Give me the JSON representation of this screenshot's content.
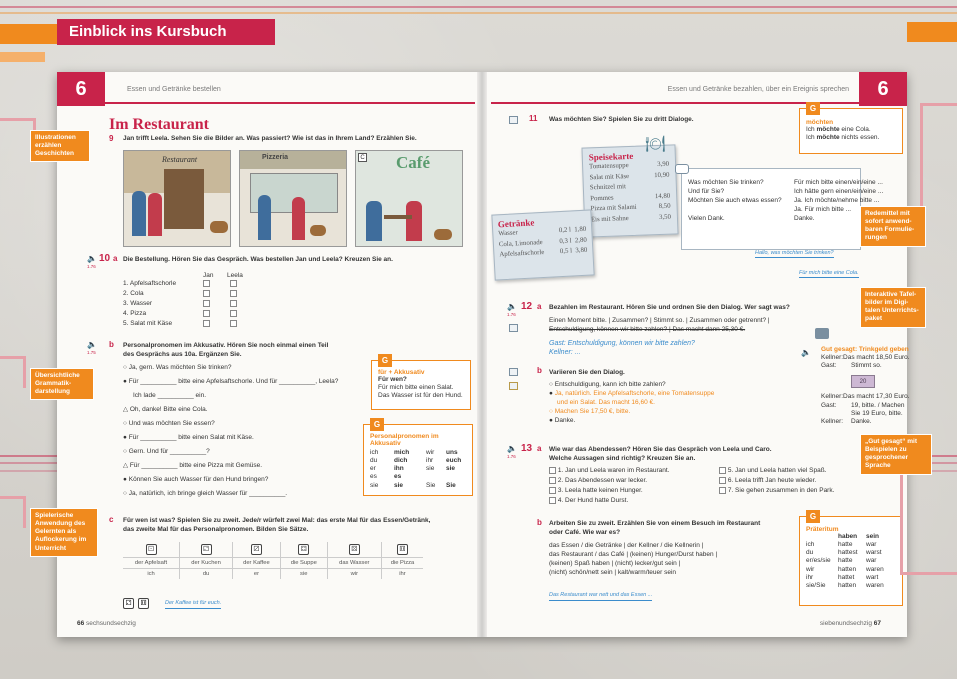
{
  "banner": {
    "title": "Einblick ins Kursbuch"
  },
  "colors": {
    "brand_red": "#c8234a",
    "accent_orange": "#f08a1e",
    "handwriting_blue": "#3b8ccc"
  },
  "left_page": {
    "chapter": "6",
    "running_head": "Essen und Getränke bestellen",
    "title": "Im Restaurant",
    "ex9": {
      "num": "9",
      "text": "Jan trifft Leela. Sehen Sie die Bilder an. Was passiert? Wie ist das in Ihrem Land? Erzählen Sie."
    },
    "illustrations": [
      {
        "label": "A",
        "sign": "Restaurant"
      },
      {
        "label": "B",
        "sign": "Pizzeria"
      },
      {
        "label": "C",
        "sign": "Café"
      }
    ],
    "ex10a": {
      "num": "10",
      "letter": "a",
      "track": "1.76",
      "text": "Die Bestellung. Hören Sie das Gespräch. Was bestellen Jan und Leela? Kreuzen Sie an.",
      "col_jan": "Jan",
      "col_leela": "Leela",
      "items": [
        "1. Apfelsaftschorle",
        "2. Cola",
        "3. Wasser",
        "4. Pizza",
        "5. Salat mit Käse"
      ]
    },
    "ex10b": {
      "letter": "b",
      "track": "1.75",
      "text1": "Personalpronomen im Akkusativ. Hören Sie noch einmal einen Teil",
      "text2": "des Gesprächs aus 10a. Ergänzen Sie.",
      "lines": [
        "Ja, gern. Was möchten Sie trinken?",
        "Für __________ bitte eine Apfelsaftschorle. Und für __________, Leela?",
        "Ich lade __________ ein.",
        "Oh, danke! Bitte eine Cola.",
        "Und was möchten Sie essen?",
        "Für __________ bitte einen Salat mit Käse.",
        "Gern. Und für __________?",
        "Für __________ bitte eine Pizza mit Gemüse.",
        "Können Sie auch Wasser für den Hund bringen?",
        "Ja, natürlich, ich bringe gleich Wasser für __________."
      ]
    },
    "grammar_fuer": {
      "badge": "G",
      "title": "für + Akkusativ",
      "lines": [
        "Für wen?",
        "Für mich bitte einen Salat.",
        "Das Wasser ist für den Hund."
      ]
    },
    "grammar_pron": {
      "badge": "G",
      "title": "Personalpronomen im Akkusativ",
      "rows": [
        [
          "ich",
          "mich",
          "wir",
          "uns"
        ],
        [
          "du",
          "dich",
          "ihr",
          "euch"
        ],
        [
          "er",
          "ihn",
          "sie",
          "sie"
        ],
        [
          "es",
          "es",
          "",
          ""
        ],
        [
          "sie",
          "sie",
          "Sie",
          "Sie"
        ]
      ]
    },
    "ex10c": {
      "letter": "c",
      "text1": "Für wen ist was? Spielen Sie zu zweit. Jede/r würfelt zwei Mal: das erste Mal für das Essen/Getränk,",
      "text2": "das zweite Mal für das Personalpronomen. Bilden Sie Sätze.",
      "dice": [
        "⚀",
        "⚁",
        "⚂",
        "⚃",
        "⚄",
        "⚅"
      ],
      "items": [
        "der Apfelsaft",
        "der Kuchen",
        "der Kaffee",
        "die Suppe",
        "das Wasser",
        "die Pizza"
      ],
      "pronouns": [
        "ich",
        "du",
        "er",
        "sie",
        "wir",
        "ihr"
      ],
      "example_dice": [
        "⚁",
        "⚅"
      ],
      "example": "Der Kaffee ist für euch."
    },
    "page_footer": {
      "num": "66",
      "word": "sechsundsechzig"
    }
  },
  "right_page": {
    "chapter": "6",
    "running_head": "Essen und Getränke bezahlen, über ein Ereignis sprechen",
    "ex11": {
      "num": "11",
      "text": "Was möchten Sie? Spielen Sie zu dritt Dialoge."
    },
    "menu_food": {
      "title": "Speisekarte",
      "items": [
        {
          "name": "Tomatensuppe",
          "price": "3,90"
        },
        {
          "name": "Salat mit Käse",
          "price": "10,90"
        },
        {
          "name": "Schnitzel mit",
          "price": ""
        },
        {
          "name": "Pommes",
          "price": "14,80"
        },
        {
          "name": "Pizza mit Salami",
          "price": "8,50"
        },
        {
          "name": "Eis mit Sahne",
          "price": "3,50"
        }
      ]
    },
    "menu_drinks": {
      "title": "Getränke",
      "items": [
        {
          "name": "Wasser",
          "size": "0,2 l",
          "price": "1,80"
        },
        {
          "name": "Cola, Limonade",
          "size": "0,3 l",
          "price": "2,80"
        },
        {
          "name": "Apfelsaftschorle",
          "size": "0,5 l",
          "price": "3,80"
        }
      ]
    },
    "dialog_left": [
      "Was möchten Sie trinken?",
      "Und für Sie?",
      "Möchten Sie auch etwas essen?",
      "",
      "Vielen Dank."
    ],
    "dialog_right": [
      "Für mich bitte einen/ein/eine ...",
      "Ich hätte gern einen/ein/eine ...",
      "Ja. Ich möchte/nehme bitte ...",
      "Ja. Für mich bitte ...",
      "Danke."
    ],
    "bubble1": "Hallo, was möchten Sie trinken?",
    "bubble2": "Für mich bitte eine Cola.",
    "grammar_moechten": {
      "badge": "G",
      "title": "möchten",
      "lines": [
        {
          "pre": "Ich ",
          "bold": "möchte",
          "post": " eine Cola."
        },
        {
          "pre": "Ich ",
          "bold": "möchte",
          "post": " nichts essen."
        }
      ]
    },
    "ex12a": {
      "num": "12",
      "letter": "a",
      "track": "1.76",
      "text": "Bezahlen im Restaurant. Hören Sie und ordnen Sie den Dialog. Wer sagt was?",
      "line1": "Einen Moment bitte.  |  Zusammen?  |  Stimmt so.  |  Zusammen oder getrennt?  |",
      "line2": "Entschuldigung, können wir bitte zahlen?  |  Das macht dann 25,30 €.",
      "hand1": "Gast: Entschuldigung, können wir bitte zahlen?",
      "hand2": "Kellner: ..."
    },
    "ex12b": {
      "letter": "b",
      "text": "Variieren Sie den Dialog.",
      "lines": [
        "Entschuldigung, kann ich bitte zahlen?",
        "Ja, natürlich. Eine Apfelsaftschorle, eine Tomatensuppe",
        "und ein Salat. Das macht 16,60 €.",
        "Machen Sie 17,50 €, bitte.",
        "Danke."
      ]
    },
    "gut_gesagt": {
      "title": "Gut gesagt: Trinkgeld geben",
      "rows1": [
        [
          "Kellner:",
          "Das macht 18,50 Euro."
        ],
        [
          "Gast:",
          "Stimmt so."
        ]
      ],
      "rows2": [
        [
          "Kellner:",
          "Das macht 17,30 Euro."
        ],
        [
          "Gast:",
          "19, bitte. / Machen"
        ],
        [
          "",
          "Sie 19 Euro, bitte."
        ],
        [
          "Kellner:",
          "Danke."
        ]
      ],
      "note_label": "20"
    },
    "ex13a": {
      "num": "13",
      "letter": "a",
      "track": "1.76",
      "text1": "Wie war das Abendessen? Hören Sie das Gespräch von Leela und Caro.",
      "text2": "Welche Aussagen sind richtig? Kreuzen Sie an.",
      "left": [
        "1. Jan und Leela waren im Restaurant.",
        "2. Das Abendessen war lecker.",
        "3. Leela hatte keinen Hunger.",
        "4. Der Hund hatte Durst."
      ],
      "right": [
        "5. Jan und Leela hatten viel Spaß.",
        "6. Leela trifft Jan heute wieder.",
        "7. Sie gehen zusammen in den Park."
      ]
    },
    "ex13b": {
      "letter": "b",
      "text1": "Arbeiten Sie zu zweit. Erzählen Sie von einem Besuch im Restaurant",
      "text2": "oder Café. Wie war es?",
      "lines": [
        "das Essen / die Getränke  |  der Kellner / die Kellnerin  |",
        "das Restaurant / das Café  |  (keinen) Hunger/Durst haben  |",
        "(keinen) Spaß haben  |  (nicht) lecker/gut sein  |",
        "(nicht) schön/nett sein  |  kalt/warm/teuer sein"
      ],
      "example": "Das Restaurant war nett und das Essen ..."
    },
    "grammar_praet": {
      "badge": "G",
      "title": "Präteritum",
      "head": [
        "",
        "haben",
        "sein"
      ],
      "rows": [
        [
          "ich",
          "hatte",
          "war"
        ],
        [
          "du",
          "hattest",
          "warst"
        ],
        [
          "er/es/sie",
          "hatte",
          "war"
        ],
        [
          "wir",
          "hatten",
          "waren"
        ],
        [
          "ihr",
          "hattet",
          "wart"
        ],
        [
          "sie/Sie",
          "hatten",
          "waren"
        ]
      ]
    },
    "page_footer": {
      "num": "67",
      "word": "siebenundsechzig"
    }
  },
  "annotations": {
    "illustrationen": "Illustrationen erzählen Geschichten",
    "uebersicht": "Übersichtliche Grammatik-darstellung",
    "spielerisch": "Spielerische Anwendung des Gelernten als Auflockerung im Unterricht",
    "redemittel": "Redemittel mit sofort anwend-baren Formulie-rungen",
    "tafelbilder": "Interaktive Tafel-bilder im Digi-talen Unterrichts-paket",
    "gutgesagt": "„Gut gesagt“ mit Beispielen zu gesprochener Sprache"
  }
}
